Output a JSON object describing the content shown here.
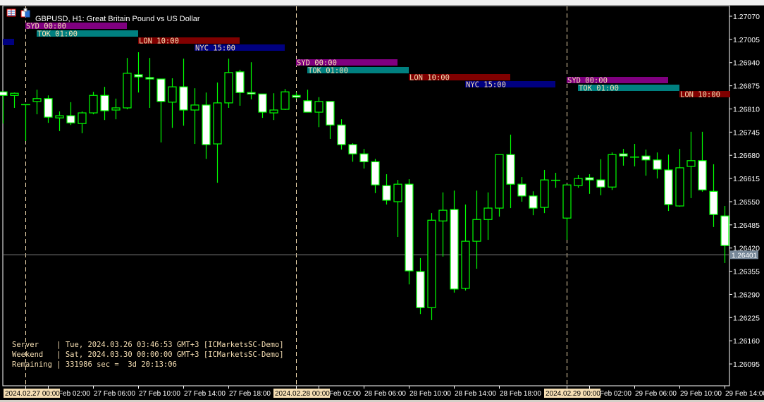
{
  "window": {
    "title": "GBPUSD, H1:  Great Britain Pound vs US Dollar",
    "icons": [
      "symbol-list-icon",
      "chart-window-icon"
    ]
  },
  "colors": {
    "background": "#000000",
    "candle_outline": "#00ff00",
    "bear_fill": "#ffffff",
    "bull_fill": "#000000",
    "axis_text": "#ffffff",
    "day_separator": "#f5deb3",
    "bid_line": "#808080",
    "bid_label_bg": "#778899",
    "info_text": "#f5deb3",
    "session_text": "#f5deb3"
  },
  "info_panel": {
    "lines": [
      "Server    | Tue, 2024.03.26 03:46:53 GMT+3 [ICMarketsSC-Demo]",
      "Weekend   | Sat, 2024.03.30 00:00:00 GMT+3 [ICMarketsSC-Demo]",
      "Remaining | 331986 sec =  3d 20:13:06"
    ]
  },
  "chart_data": {
    "type": "candlestick",
    "symbol": "GBPUSD",
    "timeframe": "H1",
    "ylim": [
      1.2606,
      1.27145
    ],
    "y_ticks": [
      "1.27070",
      "1.27005",
      "1.26940",
      "1.26875",
      "1.26810",
      "1.26745",
      "1.26680",
      "1.26615",
      "1.26550",
      "1.26485",
      "1.26420",
      "1.26355",
      "1.26290",
      "1.26225",
      "1.26160",
      "1.26095"
    ],
    "bid": "1.26401",
    "x_labels": [
      {
        "text": "2024.02.27 00:00",
        "hour": 0,
        "highlight": true
      },
      {
        "text": "27 Feb 02:00",
        "hour": 2
      },
      {
        "text": "27 Feb 06:00",
        "hour": 6
      },
      {
        "text": "27 Feb 10:00",
        "hour": 10
      },
      {
        "text": "27 Feb 14:00",
        "hour": 14
      },
      {
        "text": "27 Feb 18:00",
        "hour": 18
      },
      {
        "text": "2024.02.28 00:00",
        "hour": 24,
        "highlight": true
      },
      {
        "text": "28 Feb 02:00",
        "hour": 26
      },
      {
        "text": "28 Feb 06:00",
        "hour": 30
      },
      {
        "text": "28 Feb 10:00",
        "hour": 34
      },
      {
        "text": "28 Feb 14:00",
        "hour": 38
      },
      {
        "text": "28 Feb 18:00",
        "hour": 42
      },
      {
        "text": "2024.02.29 00:00",
        "hour": 48,
        "highlight": true
      },
      {
        "text": "29 Feb 02:00",
        "hour": 50
      },
      {
        "text": "29 Feb 06:00",
        "hour": 54
      },
      {
        "text": "29 Feb 10:00",
        "hour": 58
      },
      {
        "text": "29 Feb 14:00",
        "hour": 62
      }
    ],
    "day_separators_hours": [
      0,
      24,
      48
    ],
    "first_candle_hour": -2,
    "candles": [
      [
        1.26858,
        1.26858,
        1.26769,
        1.26775,
        1.26848
      ],
      [
        1.26848,
        1.26856,
        1.26813,
        1.26848,
        1.26854
      ],
      [
        1.26823,
        1.26823,
        1.2672,
        1.26744,
        1.26823
      ],
      [
        1.26831,
        1.26864,
        1.26795,
        1.26831,
        1.26839
      ],
      [
        1.26839,
        1.26848,
        1.26771,
        1.26839,
        1.26787
      ],
      [
        1.26785,
        1.26803,
        1.26748,
        1.26785,
        1.26791
      ],
      [
        1.26791,
        1.26829,
        1.26765,
        1.26791,
        1.26771
      ],
      [
        1.26769,
        1.26803,
        1.26742,
        1.26769,
        1.26799
      ],
      [
        1.26799,
        1.26858,
        1.26795,
        1.26799,
        1.26848
      ],
      [
        1.26848,
        1.26872,
        1.26779,
        1.26848,
        1.26805
      ],
      [
        1.26807,
        1.26839,
        1.26781,
        1.26807,
        1.26813
      ],
      [
        1.26813,
        1.26953,
        1.26809,
        1.26813,
        1.2691
      ],
      [
        1.26906,
        1.26969,
        1.26856,
        1.26906,
        1.269
      ],
      [
        1.26898,
        1.26953,
        1.26813,
        1.26898,
        1.26894
      ],
      [
        1.26894,
        1.26894,
        1.26716,
        1.26894,
        1.26831
      ],
      [
        1.26829,
        1.26896,
        1.26757,
        1.26829,
        1.26872
      ],
      [
        1.26872,
        1.26951,
        1.26763,
        1.26872,
        1.26807
      ],
      [
        1.26807,
        1.26868,
        1.26712,
        1.26807,
        1.26821
      ],
      [
        1.26821,
        1.26856,
        1.2667,
        1.26821,
        1.2671
      ],
      [
        1.26712,
        1.26884,
        1.26603,
        1.26712,
        1.26827
      ],
      [
        1.26827,
        1.26951,
        1.26813,
        1.26827,
        1.26912
      ],
      [
        1.26914,
        1.2692,
        1.26819,
        1.26914,
        1.26856
      ],
      [
        1.26856,
        1.26941,
        1.26837,
        1.26856,
        1.26852
      ],
      [
        1.26852,
        1.26852,
        1.26785,
        1.26852,
        1.26801
      ],
      [
        1.26799,
        1.26854,
        1.26779,
        1.26799,
        1.26807
      ],
      [
        1.26809,
        1.26866,
        1.26807,
        1.26809,
        1.26858
      ],
      [
        1.26848,
        1.26856,
        1.26839,
        1.26848,
        1.26843
      ],
      [
        1.26833,
        1.26864,
        1.26801,
        1.26833,
        1.26801
      ],
      [
        1.26801,
        1.26843,
        1.26759,
        1.26801,
        1.26831
      ],
      [
        1.26831,
        1.26831,
        1.26726,
        1.26831,
        1.26765
      ],
      [
        1.26765,
        1.26781,
        1.26696,
        1.26765,
        1.2671
      ],
      [
        1.2671,
        1.26714,
        1.26662,
        1.2671,
        1.26684
      ],
      [
        1.26684,
        1.26698,
        1.26643,
        1.26684,
        1.26662
      ],
      [
        1.26662,
        1.2667,
        1.26574,
        1.26662,
        1.26597
      ],
      [
        1.26595,
        1.26627,
        1.26542,
        1.26595,
        1.26554
      ],
      [
        1.2655,
        1.26611,
        1.26451,
        1.2655,
        1.26599
      ],
      [
        1.26599,
        1.26613,
        1.26318,
        1.26599,
        1.26356
      ],
      [
        1.26354,
        1.26392,
        1.26235,
        1.26354,
        1.26253
      ],
      [
        1.26253,
        1.26518,
        1.26218,
        1.26253,
        1.26498
      ],
      [
        1.26496,
        1.26576,
        1.26396,
        1.26496,
        1.26526
      ],
      [
        1.26528,
        1.26581,
        1.26295,
        1.26528,
        1.26305
      ],
      [
        1.26307,
        1.26542,
        1.26301,
        1.26307,
        1.26439
      ],
      [
        1.26439,
        1.26581,
        1.26362,
        1.26439,
        1.265
      ],
      [
        1.265,
        1.26576,
        1.26443,
        1.265,
        1.26532
      ],
      [
        1.26532,
        1.26682,
        1.26508,
        1.26532,
        1.26682
      ],
      [
        1.26682,
        1.26738,
        1.26532,
        1.26682,
        1.26599
      ],
      [
        1.26599,
        1.26619,
        1.2655,
        1.26599,
        1.26566
      ],
      [
        1.26566,
        1.26579,
        1.26512,
        1.26566,
        1.26532
      ],
      [
        1.26534,
        1.26639,
        1.26518,
        1.26534,
        1.26611
      ],
      [
        1.26611,
        1.26631,
        1.26589,
        1.26611,
        1.26611
      ],
      [
        1.26504,
        1.26597,
        1.26443,
        1.26504,
        1.26597
      ],
      [
        1.26595,
        1.26625,
        1.26589,
        1.26595,
        1.26615
      ],
      [
        1.26617,
        1.26627,
        1.26572,
        1.26617,
        1.26611
      ],
      [
        1.26611,
        1.26669,
        1.26568,
        1.26611,
        1.26591
      ],
      [
        1.26591,
        1.26688,
        1.26583,
        1.26591,
        1.26682
      ],
      [
        1.26684,
        1.26698,
        1.26651,
        1.26684,
        1.26678
      ],
      [
        1.26676,
        1.26712,
        1.26649,
        1.26676,
        1.26676
      ],
      [
        1.26678,
        1.26696,
        1.26623,
        1.26678,
        1.26667
      ],
      [
        1.26667,
        1.26688,
        1.26615,
        1.26667,
        1.26641
      ],
      [
        1.26639,
        1.26682,
        1.26524,
        1.26639,
        1.26542
      ],
      [
        1.26538,
        1.26698,
        1.26536,
        1.26538,
        1.26645
      ],
      [
        1.26649,
        1.26746,
        1.2656,
        1.26649,
        1.26665
      ],
      [
        1.26665,
        1.26746,
        1.26578,
        1.26665,
        1.26583
      ],
      [
        1.26579,
        1.26655,
        1.26479,
        1.26579,
        1.26514
      ],
      [
        1.2651,
        1.26538,
        1.26378,
        1.2651,
        1.26427
      ]
    ],
    "candle_columns": [
      "open",
      "high",
      "low",
      "open_dup",
      "close"
    ],
    "sessions": [
      {
        "label": "NYC",
        "start_hour": -2,
        "end_hour": -1,
        "color": "#000080",
        "row": 3,
        "day": 0,
        "show_label": false
      },
      {
        "label": "SYD  00:00",
        "start_hour": 0,
        "end_hour": 9,
        "color": "#800080",
        "row": 0,
        "day": 1
      },
      {
        "label": "TOK  01:00",
        "start_hour": 1,
        "end_hour": 10,
        "color": "#008080",
        "row": 1,
        "day": 1
      },
      {
        "label": "LON  10:00",
        "start_hour": 10,
        "end_hour": 19,
        "color": "#800000",
        "row": 2,
        "day": 1
      },
      {
        "label": "NYC  15:00",
        "start_hour": 15,
        "end_hour": 23,
        "color": "#000080",
        "row": 3,
        "day": 1
      },
      {
        "label": "SYD  00:00",
        "start_hour": 24,
        "end_hour": 33,
        "color": "#800080",
        "row": 0,
        "day": 2
      },
      {
        "label": "TOK  01:00",
        "start_hour": 25,
        "end_hour": 34,
        "color": "#008080",
        "row": 1,
        "day": 2
      },
      {
        "label": "LON  10:00",
        "start_hour": 34,
        "end_hour": 43,
        "color": "#800000",
        "row": 2,
        "day": 2
      },
      {
        "label": "NYC  15:00",
        "start_hour": 39,
        "end_hour": 47,
        "color": "#000080",
        "row": 3,
        "day": 2
      },
      {
        "label": "SYD  00:00",
        "start_hour": 48,
        "end_hour": 57,
        "color": "#800080",
        "row": 0,
        "day": 3
      },
      {
        "label": "TOK  01:00",
        "start_hour": 49,
        "end_hour": 58,
        "color": "#008080",
        "row": 1,
        "day": 3
      },
      {
        "label": "LON  10:00",
        "start_hour": 58,
        "end_hour": 62.5,
        "color": "#800000",
        "row": 2,
        "day": 3
      }
    ]
  }
}
